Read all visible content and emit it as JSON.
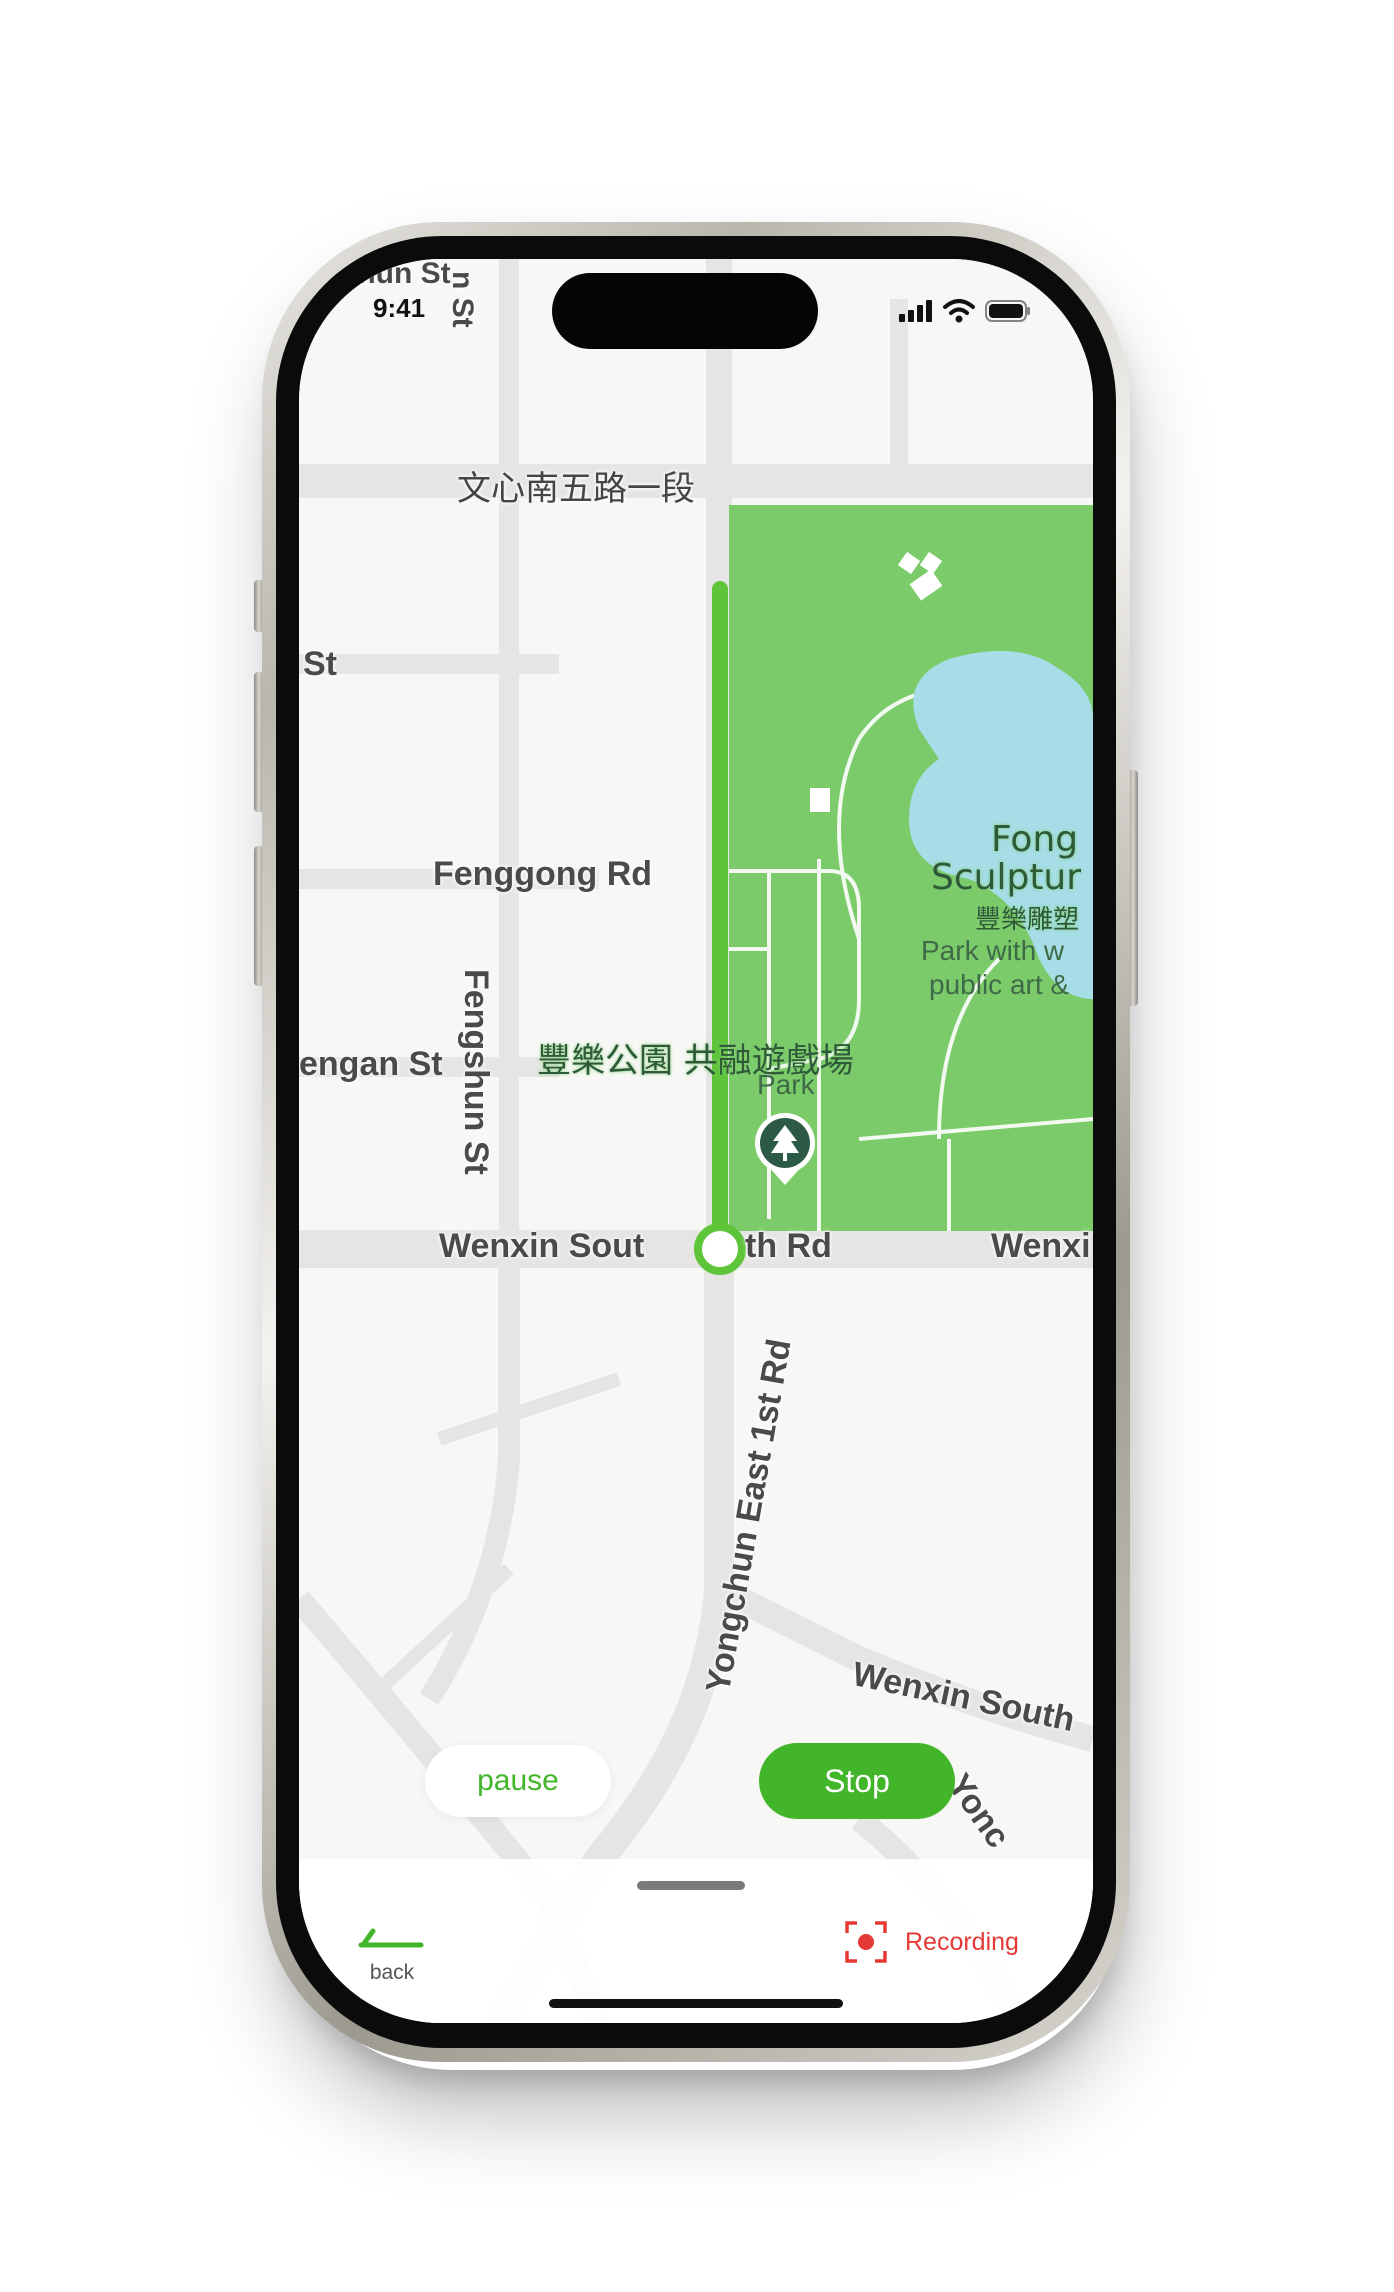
{
  "status_bar": {
    "time": "9:41"
  },
  "map": {
    "streets": {
      "top_left_partial": "unun St",
      "top_vertical_partial": "n St",
      "wenxin_5th": "文心南五路一段",
      "left_st": "St",
      "fenggong": "Fenggong Rd",
      "fengan": "engan St",
      "fengshun": "Fengshun St",
      "wenxin_south_left": "Wenxin Sout",
      "wenxin_south_mid": "th Rd",
      "wenxin_right_partial": "Wenxi",
      "yongchun": "Yongchun East 1st Rd",
      "wenxin_south_lower": "Wenxin South",
      "yongchun_partial": "Yonc"
    },
    "pois": {
      "park_name_zh": "豐樂公園 共融遊戲場",
      "park_type": "Park",
      "sculpture_title_1": "Fong",
      "sculpture_title_2": "Sculptur",
      "sculpture_zh": "豐樂雕塑",
      "sculpture_desc_1": "Park with w",
      "sculpture_desc_2": "public art &"
    }
  },
  "controls": {
    "pause_label": "pause",
    "stop_label": "Stop"
  },
  "bottom_bar": {
    "back_label": "back",
    "recording_label": "Recording"
  },
  "colors": {
    "accent_green": "#43b52a",
    "route_green": "#5ec43a",
    "park_green": "#7ccb6b",
    "water": "#a6dde6",
    "recording_red": "#e53935"
  },
  "icons": {
    "status": [
      "signal-icon",
      "wifi-icon",
      "battery-icon"
    ],
    "map": [
      "park-marker-icon",
      "tree-icon",
      "route-end-icon",
      "toilet-icon"
    ],
    "bottom": [
      "back-arrow-icon",
      "record-icon"
    ]
  }
}
